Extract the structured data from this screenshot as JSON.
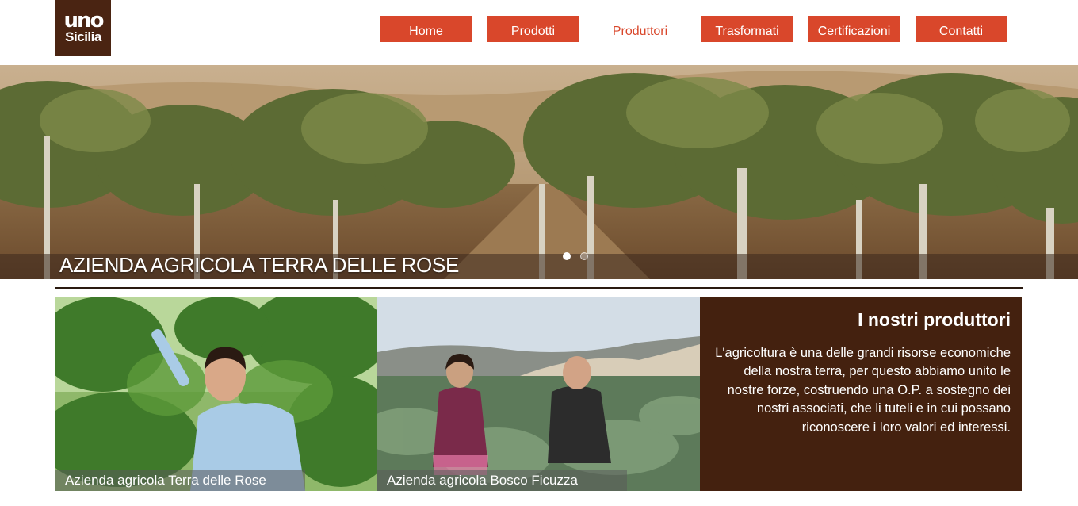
{
  "brand": {
    "logo_line1": "uno",
    "logo_line2": "Sicilia",
    "dark_brown": "#44210f",
    "accent": "#d9472b"
  },
  "nav": {
    "items": [
      {
        "label": "Home",
        "active": false
      },
      {
        "label": "Prodotti",
        "active": false
      },
      {
        "label": "Produttori",
        "active": true
      },
      {
        "label": "Trasformati",
        "active": false
      },
      {
        "label": "Certificazioni",
        "active": false
      },
      {
        "label": "Contatti",
        "active": false
      }
    ]
  },
  "hero": {
    "caption": "AZIENDA AGRICOLA TERRA DELLE ROSE",
    "slide_count": 2,
    "active_slide": 1,
    "image": "orchard-photo"
  },
  "producers": [
    {
      "label": "Azienda agricola Terra delle Rose",
      "image": "man-in-orchard-photo"
    },
    {
      "label": "Azienda agricola Bosco Ficuzza",
      "image": "artichoke-field-photo"
    }
  ],
  "info": {
    "title": "I nostri produttori",
    "text": "L'agricoltura è una delle grandi risorse economiche della nostra terra, per questo abbiamo unito le nostre forze, costruendo una O.P. a sostegno dei nostri associati, che li tuteli e in cui possano riconoscere i loro valori ed interessi."
  }
}
